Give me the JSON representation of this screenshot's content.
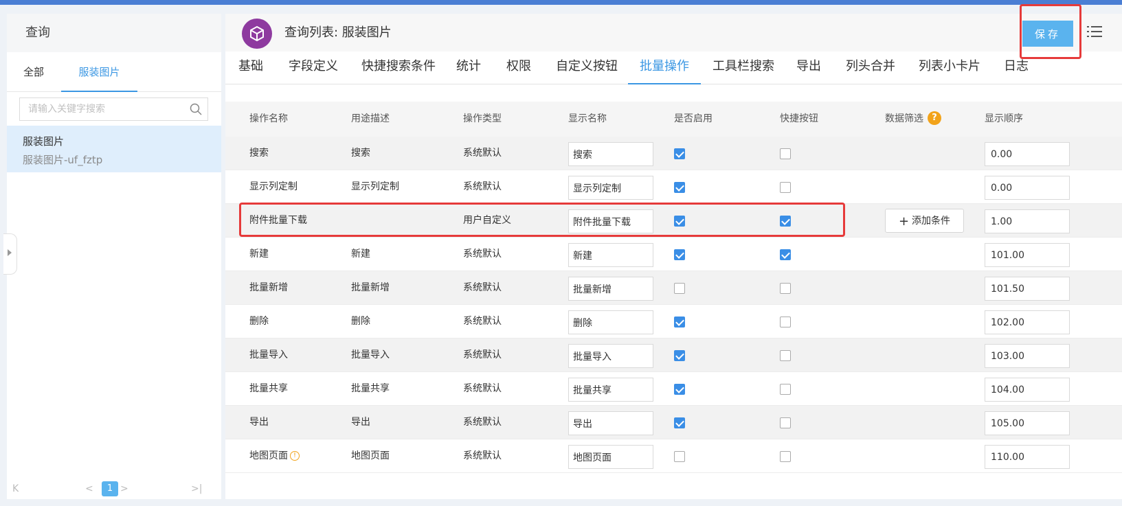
{
  "left": {
    "title": "查询",
    "tabs": [
      "全部",
      "服装图片"
    ],
    "search_placeholder": "请输入关键字搜索",
    "item": {
      "name": "服装图片",
      "sub": "服装图片-uf_fztp"
    },
    "pager": {
      "first": "K",
      "prev": "<",
      "page": "1",
      "next": ">",
      "last": ">|"
    }
  },
  "header": {
    "title": "查询列表: 服装图片",
    "save_label": "保存"
  },
  "tabs": [
    "基础",
    "字段定义",
    "快捷搜索条件",
    "统计",
    "权限",
    "自定义按钮",
    "批量操作",
    "工具栏搜索",
    "导出",
    "列头合并",
    "列表小卡片",
    "日志"
  ],
  "active_tab": "批量操作",
  "table": {
    "columns": [
      "操作名称",
      "用途描述",
      "操作类型",
      "显示名称",
      "是否启用",
      "快捷按钮",
      "数据筛选",
      "显示顺序"
    ],
    "help_glyph": "?",
    "add_condition_label": "添加条件",
    "rows": [
      {
        "name": "搜索",
        "desc": "搜索",
        "type": "系统默认",
        "display": "搜索",
        "enabled": true,
        "quick": false,
        "order": "0.00"
      },
      {
        "name": "显示列定制",
        "desc": "显示列定制",
        "type": "系统默认",
        "display": "显示列定制",
        "enabled": true,
        "quick": false,
        "order": "0.00"
      },
      {
        "name": "附件批量下载",
        "desc": "",
        "type": "用户自定义",
        "display": "附件批量下载",
        "enabled": true,
        "quick": true,
        "order": "1.00",
        "has_filter_button": true
      },
      {
        "name": "新建",
        "desc": "新建",
        "type": "系统默认",
        "display": "新建",
        "enabled": true,
        "quick": true,
        "order": "101.00"
      },
      {
        "name": "批量新增",
        "desc": "批量新增",
        "type": "系统默认",
        "display": "批量新增",
        "enabled": false,
        "quick": false,
        "order": "101.50"
      },
      {
        "name": "删除",
        "desc": "删除",
        "type": "系统默认",
        "display": "删除",
        "enabled": true,
        "quick": false,
        "order": "102.00"
      },
      {
        "name": "批量导入",
        "desc": "批量导入",
        "type": "系统默认",
        "display": "批量导入",
        "enabled": true,
        "quick": false,
        "order": "103.00"
      },
      {
        "name": "批量共享",
        "desc": "批量共享",
        "type": "系统默认",
        "display": "批量共享",
        "enabled": true,
        "quick": false,
        "order": "104.00"
      },
      {
        "name": "导出",
        "desc": "导出",
        "type": "系统默认",
        "display": "导出",
        "enabled": true,
        "quick": false,
        "order": "105.00"
      },
      {
        "name": "地图页面",
        "desc": "地图页面",
        "type": "系统默认",
        "display": "地图页面",
        "enabled": false,
        "quick": false,
        "order": "110.00",
        "warn": "!"
      }
    ]
  },
  "colors": {
    "accent": "#3b97e3",
    "save_button": "#5ab3ee",
    "highlight": "#e63a3a",
    "logo": "#8e3a9f",
    "topbar": "#4a7ed4"
  }
}
